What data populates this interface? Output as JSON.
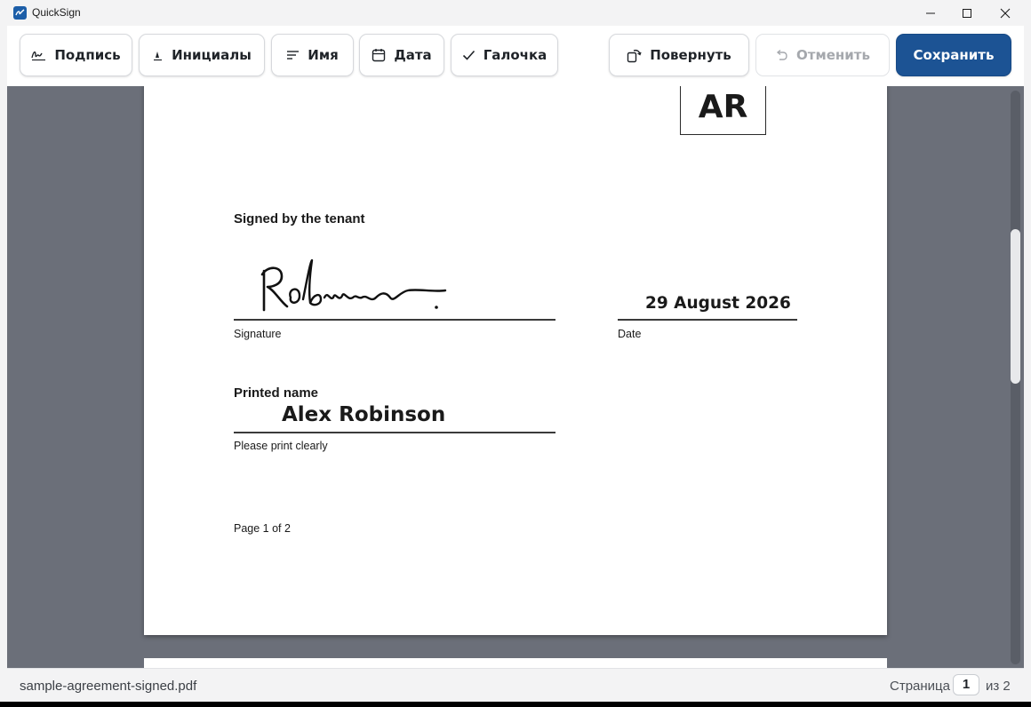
{
  "window": {
    "title": "QuickSign"
  },
  "toolbar": {
    "signature_label": "Подпись",
    "initials_label": "Инициалы",
    "name_label": "Имя",
    "date_label": "Дата",
    "check_label": "Галочка",
    "rotate_label": "Повернуть",
    "undo_label": "Отменить",
    "save_label": "Сохранить",
    "primary_color": "#1c5394"
  },
  "document": {
    "initials": "AR",
    "signed_by_heading": "Signed by the tenant",
    "signature_caption": "Signature",
    "date_value": "29 August 2026",
    "date_caption": "Date",
    "printed_name_heading": "Printed name",
    "printed_name_value": "Alex Robinson",
    "printed_name_caption": "Please print clearly",
    "page_footer": "Page 1 of 2"
  },
  "statusbar": {
    "file_name": "sample-agreement-signed.pdf",
    "page_prefix": "Страница",
    "current_page": "1",
    "page_suffix": "из 2"
  }
}
